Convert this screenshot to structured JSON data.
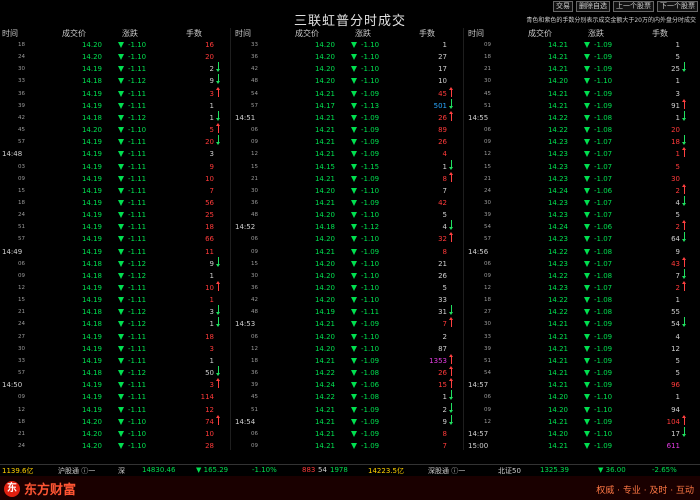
{
  "window": {
    "title": "三联虹普分时成交",
    "buttons": [
      "交易",
      "删除自选",
      "上一个股票",
      "下一个股票"
    ],
    "note": "青色和紫色的手数分别表示成交金额大于20万的内外盘分时成交"
  },
  "columns": [
    "时间",
    "成交价",
    "涨跌",
    "手数"
  ],
  "panels": [
    {
      "rows": [
        {
          "t": "18",
          "full": false,
          "p": "14.20",
          "c": "-1.10",
          "v": "16",
          "vc": "red",
          "a": ""
        },
        {
          "t": "24",
          "full": false,
          "p": "14.20",
          "c": "-1.10",
          "v": "20",
          "vc": "red",
          "a": ""
        },
        {
          "t": "30",
          "full": false,
          "p": "14.19",
          "c": "-1.11",
          "v": "2",
          "vc": "",
          "a": "dn"
        },
        {
          "t": "33",
          "full": false,
          "p": "14.18",
          "c": "-1.12",
          "v": "9",
          "vc": "",
          "a": "dn"
        },
        {
          "t": "36",
          "full": false,
          "p": "14.19",
          "c": "-1.11",
          "v": "3",
          "vc": "red",
          "a": "up"
        },
        {
          "t": "39",
          "full": false,
          "p": "14.19",
          "c": "-1.11",
          "v": "1",
          "vc": "",
          "a": ""
        },
        {
          "t": "42",
          "full": false,
          "p": "14.18",
          "c": "-1.12",
          "v": "1",
          "vc": "",
          "a": "dn"
        },
        {
          "t": "45",
          "full": false,
          "p": "14.20",
          "c": "-1.10",
          "v": "5",
          "vc": "red",
          "a": "up"
        },
        {
          "t": "57",
          "full": false,
          "p": "14.19",
          "c": "-1.11",
          "v": "20",
          "vc": "red",
          "a": "dn"
        },
        {
          "t": "14:48",
          "full": true,
          "p": "14.19",
          "c": "-1.11",
          "v": "3",
          "vc": "",
          "a": ""
        },
        {
          "t": "03",
          "full": false,
          "p": "14.19",
          "c": "-1.11",
          "v": "9",
          "vc": "red",
          "a": ""
        },
        {
          "t": "09",
          "full": false,
          "p": "14.19",
          "c": "-1.11",
          "v": "10",
          "vc": "red",
          "a": ""
        },
        {
          "t": "15",
          "full": false,
          "p": "14.19",
          "c": "-1.11",
          "v": "7",
          "vc": "red",
          "a": ""
        },
        {
          "t": "18",
          "full": false,
          "p": "14.19",
          "c": "-1.11",
          "v": "56",
          "vc": "red",
          "a": ""
        },
        {
          "t": "24",
          "full": false,
          "p": "14.19",
          "c": "-1.11",
          "v": "25",
          "vc": "red",
          "a": ""
        },
        {
          "t": "51",
          "full": false,
          "p": "14.19",
          "c": "-1.11",
          "v": "18",
          "vc": "red",
          "a": ""
        },
        {
          "t": "57",
          "full": false,
          "p": "14.19",
          "c": "-1.11",
          "v": "66",
          "vc": "red",
          "a": ""
        },
        {
          "t": "14:49",
          "full": true,
          "p": "14.19",
          "c": "-1.11",
          "v": "11",
          "vc": "red",
          "a": ""
        },
        {
          "t": "06",
          "full": false,
          "p": "14.18",
          "c": "-1.12",
          "v": "9",
          "vc": "",
          "a": "dn"
        },
        {
          "t": "09",
          "full": false,
          "p": "14.18",
          "c": "-1.12",
          "v": "1",
          "vc": "",
          "a": ""
        },
        {
          "t": "12",
          "full": false,
          "p": "14.19",
          "c": "-1.11",
          "v": "10",
          "vc": "red",
          "a": "up"
        },
        {
          "t": "15",
          "full": false,
          "p": "14.19",
          "c": "-1.11",
          "v": "1",
          "vc": "red",
          "a": ""
        },
        {
          "t": "21",
          "full": false,
          "p": "14.18",
          "c": "-1.12",
          "v": "3",
          "vc": "",
          "a": "dn"
        },
        {
          "t": "24",
          "full": false,
          "p": "14.18",
          "c": "-1.12",
          "v": "1",
          "vc": "",
          "a": "dn"
        },
        {
          "t": "27",
          "full": false,
          "p": "14.19",
          "c": "-1.11",
          "v": "18",
          "vc": "red",
          "a": ""
        },
        {
          "t": "30",
          "full": false,
          "p": "14.19",
          "c": "-1.11",
          "v": "3",
          "vc": "red",
          "a": ""
        },
        {
          "t": "33",
          "full": false,
          "p": "14.19",
          "c": "-1.11",
          "v": "1",
          "vc": "",
          "a": ""
        },
        {
          "t": "57",
          "full": false,
          "p": "14.18",
          "c": "-1.12",
          "v": "50",
          "vc": "",
          "a": "dn"
        },
        {
          "t": "14:50",
          "full": true,
          "p": "14.19",
          "c": "-1.11",
          "v": "3",
          "vc": "red",
          "a": "up"
        },
        {
          "t": "09",
          "full": false,
          "p": "14.19",
          "c": "-1.11",
          "v": "114",
          "vc": "red",
          "a": ""
        },
        {
          "t": "12",
          "full": false,
          "p": "14.19",
          "c": "-1.11",
          "v": "12",
          "vc": "red",
          "a": ""
        },
        {
          "t": "18",
          "full": false,
          "p": "14.20",
          "c": "-1.10",
          "v": "74",
          "vc": "red",
          "a": "up"
        },
        {
          "t": "21",
          "full": false,
          "p": "14.20",
          "c": "-1.10",
          "v": "10",
          "vc": "red",
          "a": ""
        },
        {
          "t": "24",
          "full": false,
          "p": "14.20",
          "c": "-1.10",
          "v": "28",
          "vc": "red",
          "a": ""
        }
      ]
    },
    {
      "rows": [
        {
          "t": "33",
          "full": false,
          "p": "14.20",
          "c": "-1.10",
          "v": "1",
          "vc": "",
          "a": ""
        },
        {
          "t": "36",
          "full": false,
          "p": "14.20",
          "c": "-1.10",
          "v": "27",
          "vc": "",
          "a": ""
        },
        {
          "t": "42",
          "full": false,
          "p": "14.20",
          "c": "-1.10",
          "v": "17",
          "vc": "",
          "a": ""
        },
        {
          "t": "48",
          "full": false,
          "p": "14.20",
          "c": "-1.10",
          "v": "10",
          "vc": "",
          "a": ""
        },
        {
          "t": "54",
          "full": false,
          "p": "14.21",
          "c": "-1.09",
          "v": "45",
          "vc": "red",
          "a": "up"
        },
        {
          "t": "57",
          "full": false,
          "p": "14.17",
          "c": "-1.13",
          "v": "501",
          "vc": "blu",
          "a": "dn"
        },
        {
          "t": "14:51",
          "full": true,
          "p": "14.21",
          "c": "-1.09",
          "v": "26",
          "vc": "red",
          "a": "up"
        },
        {
          "t": "06",
          "full": false,
          "p": "14.21",
          "c": "-1.09",
          "v": "89",
          "vc": "red",
          "a": ""
        },
        {
          "t": "09",
          "full": false,
          "p": "14.21",
          "c": "-1.09",
          "v": "26",
          "vc": "red",
          "a": ""
        },
        {
          "t": "12",
          "full": false,
          "p": "14.21",
          "c": "-1.09",
          "v": "4",
          "vc": "red",
          "a": ""
        },
        {
          "t": "15",
          "full": false,
          "p": "14.15",
          "c": "-1.15",
          "v": "1",
          "vc": "",
          "a": "dn"
        },
        {
          "t": "21",
          "full": false,
          "p": "14.21",
          "c": "-1.09",
          "v": "8",
          "vc": "red",
          "a": "up"
        },
        {
          "t": "30",
          "full": false,
          "p": "14.20",
          "c": "-1.10",
          "v": "7",
          "vc": "",
          "a": ""
        },
        {
          "t": "36",
          "full": false,
          "p": "14.21",
          "c": "-1.09",
          "v": "42",
          "vc": "red",
          "a": ""
        },
        {
          "t": "48",
          "full": false,
          "p": "14.20",
          "c": "-1.10",
          "v": "5",
          "vc": "",
          "a": ""
        },
        {
          "t": "14:52",
          "full": true,
          "p": "14.18",
          "c": "-1.12",
          "v": "4",
          "vc": "",
          "a": "dn"
        },
        {
          "t": "06",
          "full": false,
          "p": "14.20",
          "c": "-1.10",
          "v": "32",
          "vc": "red",
          "a": "up"
        },
        {
          "t": "09",
          "full": false,
          "p": "14.21",
          "c": "-1.09",
          "v": "8",
          "vc": "red",
          "a": ""
        },
        {
          "t": "15",
          "full": false,
          "p": "14.20",
          "c": "-1.10",
          "v": "21",
          "vc": "",
          "a": ""
        },
        {
          "t": "30",
          "full": false,
          "p": "14.20",
          "c": "-1.10",
          "v": "26",
          "vc": "",
          "a": ""
        },
        {
          "t": "36",
          "full": false,
          "p": "14.20",
          "c": "-1.10",
          "v": "5",
          "vc": "",
          "a": ""
        },
        {
          "t": "42",
          "full": false,
          "p": "14.20",
          "c": "-1.10",
          "v": "33",
          "vc": "",
          "a": ""
        },
        {
          "t": "48",
          "full": false,
          "p": "14.19",
          "c": "-1.11",
          "v": "31",
          "vc": "",
          "a": "dn"
        },
        {
          "t": "14:53",
          "full": true,
          "p": "14.21",
          "c": "-1.09",
          "v": "7",
          "vc": "red",
          "a": "up"
        },
        {
          "t": "06",
          "full": false,
          "p": "14.20",
          "c": "-1.10",
          "v": "2",
          "vc": "",
          "a": ""
        },
        {
          "t": "12",
          "full": false,
          "p": "14.20",
          "c": "-1.10",
          "v": "87",
          "vc": "",
          "a": ""
        },
        {
          "t": "18",
          "full": false,
          "p": "14.21",
          "c": "-1.09",
          "v": "1353",
          "vc": "mag",
          "a": "up"
        },
        {
          "t": "36",
          "full": false,
          "p": "14.22",
          "c": "-1.08",
          "v": "26",
          "vc": "red",
          "a": "up"
        },
        {
          "t": "39",
          "full": false,
          "p": "14.24",
          "c": "-1.06",
          "v": "15",
          "vc": "red",
          "a": "up"
        },
        {
          "t": "45",
          "full": false,
          "p": "14.22",
          "c": "-1.08",
          "v": "1",
          "vc": "",
          "a": "dn"
        },
        {
          "t": "51",
          "full": false,
          "p": "14.21",
          "c": "-1.09",
          "v": "2",
          "vc": "",
          "a": "dn"
        },
        {
          "t": "14:54",
          "full": true,
          "p": "14.21",
          "c": "-1.09",
          "v": "9",
          "vc": "",
          "a": "dn"
        },
        {
          "t": "06",
          "full": false,
          "p": "14.21",
          "c": "-1.09",
          "v": "8",
          "vc": "red",
          "a": ""
        },
        {
          "t": "09",
          "full": false,
          "p": "14.21",
          "c": "-1.09",
          "v": "7",
          "vc": "red",
          "a": ""
        }
      ]
    },
    {
      "rows": [
        {
          "t": "09",
          "full": false,
          "p": "14.21",
          "c": "-1.09",
          "v": "1",
          "vc": "",
          "a": ""
        },
        {
          "t": "18",
          "full": false,
          "p": "14.21",
          "c": "-1.09",
          "v": "5",
          "vc": "",
          "a": ""
        },
        {
          "t": "21",
          "full": false,
          "p": "14.21",
          "c": "-1.09",
          "v": "25",
          "vc": "",
          "a": "dn"
        },
        {
          "t": "30",
          "full": false,
          "p": "14.20",
          "c": "-1.10",
          "v": "1",
          "vc": "",
          "a": ""
        },
        {
          "t": "45",
          "full": false,
          "p": "14.21",
          "c": "-1.09",
          "v": "3",
          "vc": "",
          "a": ""
        },
        {
          "t": "51",
          "full": false,
          "p": "14.21",
          "c": "-1.09",
          "v": "91",
          "vc": "",
          "a": "up"
        },
        {
          "t": "14:55",
          "full": true,
          "p": "14.22",
          "c": "-1.08",
          "v": "1",
          "vc": "",
          "a": "dn"
        },
        {
          "t": "06",
          "full": false,
          "p": "14.22",
          "c": "-1.08",
          "v": "20",
          "vc": "red",
          "a": ""
        },
        {
          "t": "09",
          "full": false,
          "p": "14.23",
          "c": "-1.07",
          "v": "18",
          "vc": "red",
          "a": "dn"
        },
        {
          "t": "12",
          "full": false,
          "p": "14.23",
          "c": "-1.07",
          "v": "1",
          "vc": "red",
          "a": "up"
        },
        {
          "t": "15",
          "full": false,
          "p": "14.23",
          "c": "-1.07",
          "v": "5",
          "vc": "red",
          "a": ""
        },
        {
          "t": "21",
          "full": false,
          "p": "14.23",
          "c": "-1.07",
          "v": "30",
          "vc": "red",
          "a": ""
        },
        {
          "t": "24",
          "full": false,
          "p": "14.24",
          "c": "-1.06",
          "v": "2",
          "vc": "red",
          "a": "up"
        },
        {
          "t": "30",
          "full": false,
          "p": "14.23",
          "c": "-1.07",
          "v": "4",
          "vc": "",
          "a": "dn"
        },
        {
          "t": "39",
          "full": false,
          "p": "14.23",
          "c": "-1.07",
          "v": "5",
          "vc": "",
          "a": ""
        },
        {
          "t": "54",
          "full": false,
          "p": "14.24",
          "c": "-1.06",
          "v": "2",
          "vc": "red",
          "a": "up"
        },
        {
          "t": "57",
          "full": false,
          "p": "14.23",
          "c": "-1.07",
          "v": "64",
          "vc": "",
          "a": "dn"
        },
        {
          "t": "14:56",
          "full": true,
          "p": "14.22",
          "c": "-1.08",
          "v": "9",
          "vc": "",
          "a": ""
        },
        {
          "t": "06",
          "full": false,
          "p": "14.23",
          "c": "-1.07",
          "v": "43",
          "vc": "red",
          "a": "up"
        },
        {
          "t": "09",
          "full": false,
          "p": "14.22",
          "c": "-1.08",
          "v": "7",
          "vc": "",
          "a": "dn"
        },
        {
          "t": "12",
          "full": false,
          "p": "14.23",
          "c": "-1.07",
          "v": "2",
          "vc": "red",
          "a": "up"
        },
        {
          "t": "18",
          "full": false,
          "p": "14.22",
          "c": "-1.08",
          "v": "1",
          "vc": "",
          "a": ""
        },
        {
          "t": "27",
          "full": false,
          "p": "14.22",
          "c": "-1.08",
          "v": "55",
          "vc": "",
          "a": ""
        },
        {
          "t": "30",
          "full": false,
          "p": "14.21",
          "c": "-1.09",
          "v": "54",
          "vc": "",
          "a": "dn"
        },
        {
          "t": "33",
          "full": false,
          "p": "14.21",
          "c": "-1.09",
          "v": "4",
          "vc": "",
          "a": ""
        },
        {
          "t": "39",
          "full": false,
          "p": "14.21",
          "c": "-1.09",
          "v": "12",
          "vc": "",
          "a": ""
        },
        {
          "t": "51",
          "full": false,
          "p": "14.21",
          "c": "-1.09",
          "v": "5",
          "vc": "",
          "a": ""
        },
        {
          "t": "54",
          "full": false,
          "p": "14.21",
          "c": "-1.09",
          "v": "5",
          "vc": "",
          "a": ""
        },
        {
          "t": "14:57",
          "full": true,
          "p": "14.21",
          "c": "-1.09",
          "v": "96",
          "vc": "red",
          "a": ""
        },
        {
          "t": "06",
          "full": false,
          "p": "14.20",
          "c": "-1.10",
          "v": "1",
          "vc": "",
          "a": ""
        },
        {
          "t": "09",
          "full": false,
          "p": "14.20",
          "c": "-1.10",
          "v": "94",
          "vc": "",
          "a": ""
        },
        {
          "t": "12",
          "full": false,
          "p": "14.21",
          "c": "-1.09",
          "v": "104",
          "vc": "red",
          "a": "up"
        },
        {
          "t": "14:57",
          "full": true,
          "p": "14.20",
          "c": "-1.10",
          "v": "17",
          "vc": "",
          "a": "dn"
        },
        {
          "t": "15:00",
          "full": true,
          "p": "14.21",
          "c": "-1.09",
          "v": "611",
          "vc": "mag",
          "a": ""
        }
      ]
    }
  ],
  "status": {
    "s1": "1139.6亿",
    "s2": "沪股通 ⓘ一",
    "s3": "深",
    "s4": "14830.46",
    "s5": "165.29",
    "s6": "-1.10%",
    "s7": "883",
    "s8": "54",
    "s9": "1978",
    "s10": "14223.5亿",
    "s11": "深股通 ⓘ一",
    "s12": "北证50",
    "s13": "1325.39",
    "s14": "36.00",
    "s15": "-2.65%"
  },
  "footer": {
    "brand": "东方财富",
    "slogan": "权威 · 专业 · 及时 · 互动"
  },
  "colors": {
    "up": "#ff3a3a",
    "down": "#00e050",
    "big_inner": "#2aa7ff",
    "big_outer": "#e23ce2"
  }
}
